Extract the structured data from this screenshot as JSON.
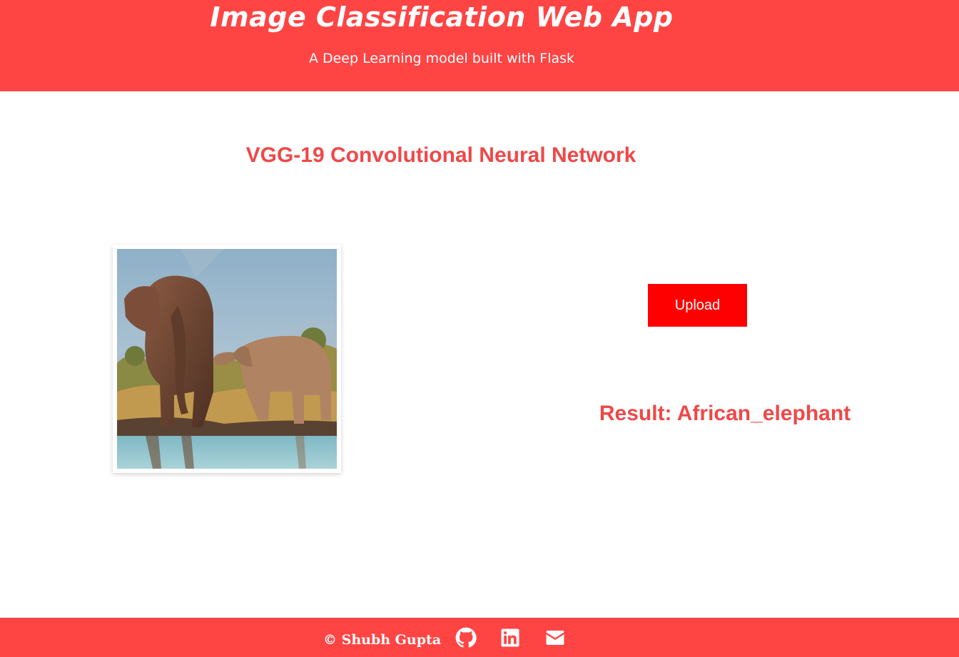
{
  "header": {
    "title": "Image Classification Web App",
    "subtitle": "A Deep Learning model built with Flask"
  },
  "main": {
    "heading": "VGG-19 Convolutional Neural Network",
    "upload_label": "Upload",
    "result_text": "Result: African_elephant"
  },
  "footer": {
    "copyright": "© Shubh Gupta",
    "icons": [
      "github-icon",
      "linkedin-icon",
      "envelope-icon"
    ]
  },
  "colors": {
    "brand": "#ff4444",
    "button": "#ff0000",
    "heading": "#ef4848",
    "text_on_brand": "#ffffff"
  }
}
